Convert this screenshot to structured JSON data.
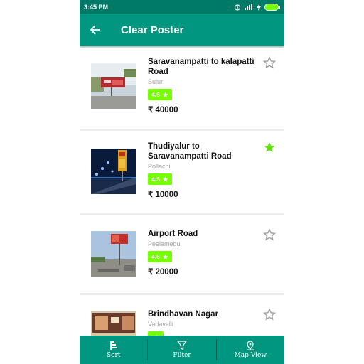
{
  "status_bar": {
    "time": "3:45 PM",
    "icons": [
      "alarm-icon",
      "signal-icon",
      "charging-icon",
      "battery-icon"
    ]
  },
  "app_bar": {
    "back_icon": "arrow-left-icon",
    "title": "Clear Poster"
  },
  "listings": [
    {
      "name": "Saravanampatti to kalapatti Road",
      "location": "Sulur",
      "rating": "4.5",
      "price": "₹ 40000",
      "favorite": false
    },
    {
      "name": "Thudiyalur to Saravanampatti Road",
      "location": "Pollachi",
      "rating": "4.5",
      "price": "₹ 10000",
      "favorite": true
    },
    {
      "name": "Airport Road",
      "location": "Peelamedu",
      "rating": "4.6",
      "price": "₹ 20000",
      "favorite": false
    },
    {
      "name": "Brindhavan Nagar",
      "location": "Vadavalli",
      "rating": "",
      "price": "",
      "favorite": false
    }
  ],
  "bottom_nav": {
    "sort_label": "Sort",
    "filter_label": "Filter",
    "map_label": "Map View"
  },
  "colors": {
    "primary": "#00967f",
    "primary_dark": "#007a68",
    "rating_badge": "#76ff03",
    "favorite_active": "#64dd17",
    "favorite_inactive": "#9e9e9e"
  }
}
